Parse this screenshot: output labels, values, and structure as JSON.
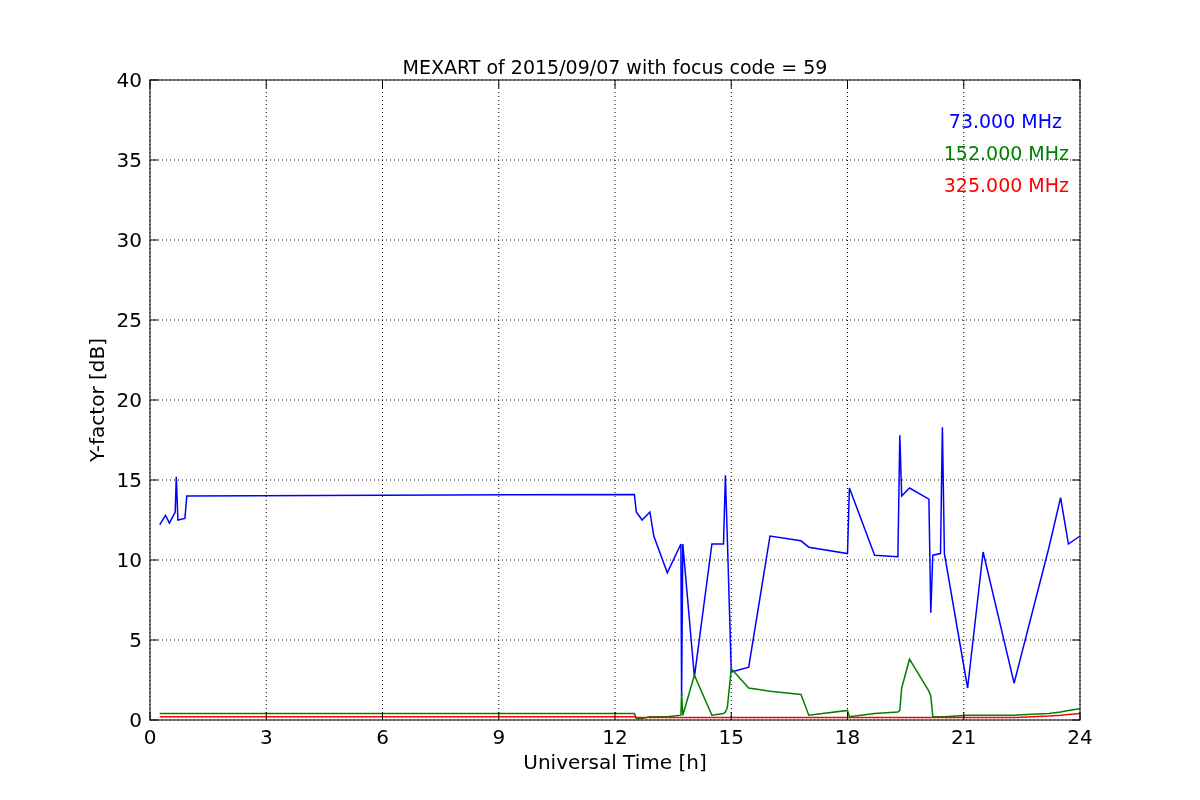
{
  "chart_data": {
    "type": "line",
    "title": "MEXART of 2015/09/07 with focus code = 59",
    "xlabel": "Universal Time [h]",
    "ylabel": "Y-factor [dB]",
    "x": [
      0.25,
      0.4,
      0.5,
      0.65,
      0.68,
      0.72,
      0.9,
      0.95,
      12.5,
      12.55,
      12.7,
      12.9,
      13.0,
      13.35,
      13.7,
      13.72,
      13.75,
      14.05,
      14.5,
      14.8,
      14.85,
      14.9,
      15.0,
      15.45,
      16.0,
      16.8,
      17.0,
      18.0,
      18.05,
      18.7,
      19.3,
      19.35,
      19.4,
      19.6,
      20.1,
      20.15,
      20.2,
      20.4,
      20.45,
      20.5,
      21.1,
      21.5,
      22.3,
      23.2,
      23.5,
      23.7,
      24.0
    ],
    "series": [
      {
        "name": "73.000 MHz",
        "color": "#0000ff",
        "values": [
          12.2,
          12.8,
          12.3,
          13.0,
          15.2,
          12.5,
          12.6,
          14.0,
          14.1,
          13.0,
          12.5,
          13.0,
          11.5,
          9.2,
          11.0,
          1.5,
          11.0,
          2.7,
          11.0,
          11.0,
          15.3,
          11.2,
          3.0,
          3.3,
          11.5,
          11.2,
          10.8,
          10.4,
          14.5,
          10.3,
          10.2,
          17.8,
          14.0,
          14.5,
          13.8,
          6.7,
          10.3,
          10.4,
          18.3,
          10.4,
          2.0,
          10.5,
          2.3,
          10.8,
          13.9,
          11.0,
          11.5
        ]
      },
      {
        "name": "152.000 MHz",
        "color": "#008000",
        "values": [
          0.4,
          0.4,
          0.4,
          0.4,
          0.4,
          0.4,
          0.4,
          0.4,
          0.4,
          0.1,
          0.1,
          0.2,
          0.2,
          0.2,
          0.3,
          1.7,
          0.3,
          2.8,
          0.3,
          0.4,
          0.5,
          0.8,
          3.2,
          2.0,
          1.8,
          1.6,
          0.3,
          0.6,
          0.2,
          0.4,
          0.5,
          0.6,
          2.0,
          3.8,
          1.8,
          1.5,
          0.2,
          0.2,
          0.2,
          0.2,
          0.3,
          0.3,
          0.3,
          0.4,
          0.5,
          0.6,
          0.7
        ]
      },
      {
        "name": "325.000 MHz",
        "color": "#ff0000",
        "values": [
          0.2,
          0.2,
          0.2,
          0.2,
          0.2,
          0.2,
          0.2,
          0.2,
          0.2,
          0.15,
          0.15,
          0.15,
          0.15,
          0.15,
          0.15,
          0.15,
          0.15,
          0.15,
          0.15,
          0.15,
          0.15,
          0.15,
          0.15,
          0.15,
          0.15,
          0.15,
          0.15,
          0.15,
          0.15,
          0.15,
          0.15,
          0.15,
          0.15,
          0.15,
          0.15,
          0.15,
          0.15,
          0.15,
          0.15,
          0.15,
          0.15,
          0.15,
          0.15,
          0.25,
          0.3,
          0.35,
          0.4
        ]
      }
    ],
    "grid": true,
    "xlim": [
      0,
      24
    ],
    "ylim": [
      0,
      40
    ],
    "xticks": [
      0,
      3,
      6,
      9,
      12,
      15,
      18,
      21,
      24
    ],
    "yticks": [
      0,
      5,
      10,
      15,
      20,
      25,
      30,
      35,
      40
    ]
  }
}
